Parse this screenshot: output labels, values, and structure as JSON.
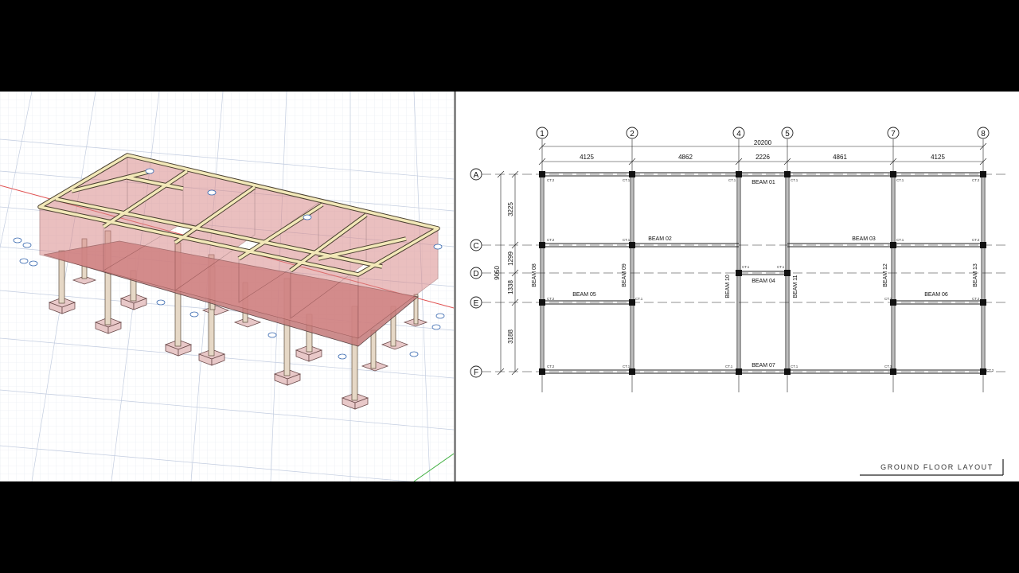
{
  "plan": {
    "title": "GROUND FLOOR LAYOUT",
    "total_width": "20200",
    "total_height": "9050",
    "grid_columns": [
      {
        "id": "col-1",
        "label": "1"
      },
      {
        "id": "col-2",
        "label": "2"
      },
      {
        "id": "col-4",
        "label": "4"
      },
      {
        "id": "col-5",
        "label": "5"
      },
      {
        "id": "col-7",
        "label": "7"
      },
      {
        "id": "col-8",
        "label": "8"
      }
    ],
    "grid_rows": [
      {
        "id": "row-a",
        "label": "A"
      },
      {
        "id": "row-c",
        "label": "C"
      },
      {
        "id": "row-d",
        "label": "D"
      },
      {
        "id": "row-e",
        "label": "E"
      },
      {
        "id": "row-f",
        "label": "F"
      }
    ],
    "col_spacings": [
      "4125",
      "4862",
      "2226",
      "4861",
      "4125"
    ],
    "row_spacings": [
      "3225",
      "1299",
      "1338",
      "3188"
    ],
    "beams_horizontal": {
      "b01": "BEAM 01",
      "b02": "BEAM 02",
      "b03": "BEAM 03",
      "b04": "BEAM 04",
      "b05": "BEAM 05",
      "b06": "BEAM 06",
      "b07": "BEAM 07"
    },
    "beams_vertical": {
      "b08": "BEAM 08",
      "b09": "BEAM 09",
      "b10": "BEAM 10",
      "b11": "BEAM 11",
      "b12": "BEAM 12",
      "b13": "BEAM 13"
    },
    "column_tags": {
      "ct1": "CT.1",
      "ct2": "CT.2"
    }
  },
  "viewport3d": {
    "grid_color": "#b8c4d6",
    "frame_color": "#f2e8b8",
    "wall_color": "#d98b8b",
    "axis_x_color": "#e05050",
    "axis_y_color": "#40b040"
  }
}
